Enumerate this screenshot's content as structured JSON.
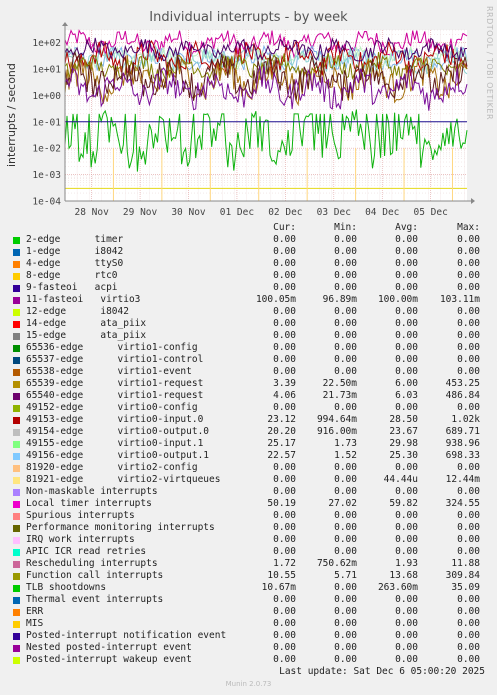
{
  "chart_data": {
    "type": "line",
    "title": "Individual interrupts - by week",
    "ylabel": "interrupts / second",
    "xlabel": "",
    "yscale": "log",
    "ylim": [
      0.0001,
      300
    ],
    "y_ticks": [
      {
        "value": 0.0001,
        "label": "1e-04"
      },
      {
        "value": 0.001,
        "label": "1e-03"
      },
      {
        "value": 0.01,
        "label": "1e-02"
      },
      {
        "value": 0.1,
        "label": "1e-01"
      },
      {
        "value": 1,
        "label": "1e+00"
      },
      {
        "value": 10,
        "label": "1e+01"
      },
      {
        "value": 100,
        "label": "1e+02"
      }
    ],
    "x_ticks": [
      "28 Nov",
      "29 Nov",
      "30 Nov",
      "01 Dec",
      "02 Dec",
      "03 Dec",
      "04 Dec",
      "05 Dec"
    ],
    "x_range_days": [
      0,
      8.3
    ],
    "grid": true,
    "series_bands": [
      {
        "name": "11-fasteoi   virtio3",
        "color": "#CC0099",
        "center": 100,
        "spread": 0.35
      },
      {
        "name": "49156-edge     virtio0-output.1",
        "color": "#7FB2E5",
        "center": 25,
        "spread": 0.3
      },
      {
        "name": "49155-edge     virtio0-input.1",
        "color": "#C0F0C0",
        "center": 28,
        "spread": 0.3
      },
      {
        "name": "49154-edge     virtio0-output.0",
        "color": "#8CD2D2",
        "center": 22,
        "spread": 0.35
      },
      {
        "name": "49153-edge     virtio0-input.0",
        "color": "#B50000",
        "center": 25,
        "spread": 0.45
      },
      {
        "name": "Local timer interrupts",
        "color": "#4C0066",
        "center": 55,
        "spread": 0.3
      },
      {
        "name": "Function call interrupts",
        "color": "#808000",
        "center": 12,
        "spread": 0.35
      },
      {
        "name": "65539-edge     virtio1-request",
        "color": "#A6700E",
        "center": 4,
        "spread": 0.6
      },
      {
        "name": "65540-edge     virtio1-request",
        "color": "#5C1A1A",
        "center": 5,
        "spread": 0.6
      },
      {
        "name": "Rescheduling interrupts",
        "color": "#7A0F99",
        "center": 1.8,
        "spread": 0.55
      },
      {
        "name": "TLB shootdowns",
        "color": "#0DB20D",
        "center": 0.02,
        "spread": 0.8
      }
    ],
    "flat_series": [
      {
        "name": "11-fasteoi   virtio3",
        "color": "#1F0F8F",
        "value": 0.1
      },
      {
        "name": "Performance monitoring interrupts",
        "color": "#E5D919",
        "value": 0.0003
      }
    ]
  },
  "legend": {
    "headers": [
      "Cur:",
      "Min:",
      "Avg:",
      "Max:"
    ],
    "rows": [
      {
        "label": "2-edge      timer",
        "color": "#00CC00",
        "cur": "0.00",
        "min": "0.00",
        "avg": "0.00",
        "max": "0.00"
      },
      {
        "label": "1-edge      i8042",
        "color": "#0066B3",
        "cur": "0.00",
        "min": "0.00",
        "avg": "0.00",
        "max": "0.00"
      },
      {
        "label": "4-edge      ttyS0",
        "color": "#FF8000",
        "cur": "0.00",
        "min": "0.00",
        "avg": "0.00",
        "max": "0.00"
      },
      {
        "label": "8-edge      rtc0",
        "color": "#FFCC00",
        "cur": "0.00",
        "min": "0.00",
        "avg": "0.00",
        "max": "0.00"
      },
      {
        "label": "9-fasteoi   acpi",
        "color": "#330099",
        "cur": "0.00",
        "min": "0.00",
        "avg": "0.00",
        "max": "0.00"
      },
      {
        "label": "11-fasteoi   virtio3",
        "color": "#990099",
        "cur": "100.05m",
        "min": "96.89m",
        "avg": "100.00m",
        "max": "103.11m"
      },
      {
        "label": "12-edge      i8042",
        "color": "#CCFF00",
        "cur": "0.00",
        "min": "0.00",
        "avg": "0.00",
        "max": "0.00"
      },
      {
        "label": "14-edge      ata_piix",
        "color": "#FF0000",
        "cur": "0.00",
        "min": "0.00",
        "avg": "0.00",
        "max": "0.00"
      },
      {
        "label": "15-edge      ata_piix",
        "color": "#808080",
        "cur": "0.00",
        "min": "0.00",
        "avg": "0.00",
        "max": "0.00"
      },
      {
        "label": "65536-edge      virtio1-config",
        "color": "#008F00",
        "cur": "0.00",
        "min": "0.00",
        "avg": "0.00",
        "max": "0.00"
      },
      {
        "label": "65537-edge      virtio1-control",
        "color": "#00487D",
        "cur": "0.00",
        "min": "0.00",
        "avg": "0.00",
        "max": "0.00"
      },
      {
        "label": "65538-edge      virtio1-event",
        "color": "#B35A00",
        "cur": "0.00",
        "min": "0.00",
        "avg": "0.00",
        "max": "0.00"
      },
      {
        "label": "65539-edge      virtio1-request",
        "color": "#B38F00",
        "cur": "3.39",
        "min": "22.50m",
        "avg": "6.00",
        "max": "453.25"
      },
      {
        "label": "65540-edge      virtio1-request",
        "color": "#6B006B",
        "cur": "4.06",
        "min": "21.73m",
        "avg": "6.03",
        "max": "486.84"
      },
      {
        "label": "49152-edge      virtio0-config",
        "color": "#8FB300",
        "cur": "0.00",
        "min": "0.00",
        "avg": "0.00",
        "max": "0.00"
      },
      {
        "label": "49153-edge      virtio0-input.0",
        "color": "#B30000",
        "cur": "23.12",
        "min": "994.64m",
        "avg": "28.50",
        "max": "1.02k"
      },
      {
        "label": "49154-edge      virtio0-output.0",
        "color": "#BEBEBE",
        "cur": "20.20",
        "min": "916.00m",
        "avg": "23.67",
        "max": "689.71"
      },
      {
        "label": "49155-edge      virtio0-input.1",
        "color": "#80FF80",
        "cur": "25.17",
        "min": "1.73",
        "avg": "29.98",
        "max": "938.96"
      },
      {
        "label": "49156-edge      virtio0-output.1",
        "color": "#80C9FF",
        "cur": "22.57",
        "min": "1.52",
        "avg": "25.30",
        "max": "698.33"
      },
      {
        "label": "81920-edge      virtio2-config",
        "color": "#FFC080",
        "cur": "0.00",
        "min": "0.00",
        "avg": "0.00",
        "max": "0.00"
      },
      {
        "label": "81921-edge      virtio2-virtqueues",
        "color": "#FFE680",
        "cur": "0.00",
        "min": "0.00",
        "avg": "44.44u",
        "max": "12.44m"
      },
      {
        "label": "Non-maskable interrupts",
        "color": "#AA80FF",
        "cur": "0.00",
        "min": "0.00",
        "avg": "0.00",
        "max": "0.00"
      },
      {
        "label": "Local timer interrupts",
        "color": "#EE00CC",
        "cur": "50.19",
        "min": "27.02",
        "avg": "59.82",
        "max": "324.55"
      },
      {
        "label": "Spurious interrupts",
        "color": "#FF8080",
        "cur": "0.00",
        "min": "0.00",
        "avg": "0.00",
        "max": "0.00"
      },
      {
        "label": "Performance monitoring interrupts",
        "color": "#666600",
        "cur": "0.00",
        "min": "0.00",
        "avg": "0.00",
        "max": "0.00"
      },
      {
        "label": "IRQ work interrupts",
        "color": "#FFBFFF",
        "cur": "0.00",
        "min": "0.00",
        "avg": "0.00",
        "max": "0.00"
      },
      {
        "label": "APIC ICR read retries",
        "color": "#00FFCC",
        "cur": "0.00",
        "min": "0.00",
        "avg": "0.00",
        "max": "0.00"
      },
      {
        "label": "Rescheduling interrupts",
        "color": "#CC6699",
        "cur": "1.72",
        "min": "750.62m",
        "avg": "1.93",
        "max": "11.88"
      },
      {
        "label": "Function call interrupts",
        "color": "#999900",
        "cur": "10.55",
        "min": "5.71",
        "avg": "13.68",
        "max": "309.84"
      },
      {
        "label": "TLB shootdowns",
        "color": "#00CC00",
        "cur": "10.67m",
        "min": "0.00",
        "avg": "263.60m",
        "max": "35.09"
      },
      {
        "label": "Thermal event interrupts",
        "color": "#0066B3",
        "cur": "0.00",
        "min": "0.00",
        "avg": "0.00",
        "max": "0.00"
      },
      {
        "label": "ERR",
        "color": "#FF8000",
        "cur": "0.00",
        "min": "0.00",
        "avg": "0.00",
        "max": "0.00"
      },
      {
        "label": "MIS",
        "color": "#FFCC00",
        "cur": "0.00",
        "min": "0.00",
        "avg": "0.00",
        "max": "0.00"
      },
      {
        "label": "Posted-interrupt notification event",
        "color": "#330099",
        "cur": "0.00",
        "min": "0.00",
        "avg": "0.00",
        "max": "0.00"
      },
      {
        "label": "Nested posted-interrupt event",
        "color": "#990099",
        "cur": "0.00",
        "min": "0.00",
        "avg": "0.00",
        "max": "0.00"
      },
      {
        "label": "Posted-interrupt wakeup event",
        "color": "#CCFF00",
        "cur": "0.00",
        "min": "0.00",
        "avg": "0.00",
        "max": "0.00"
      }
    ]
  },
  "side_label": "RRDTOOL / TOBI OETIKER",
  "last_update": "Last update: Sat Dec  6 05:00:20 2025",
  "footer": "Munin 2.0.73"
}
